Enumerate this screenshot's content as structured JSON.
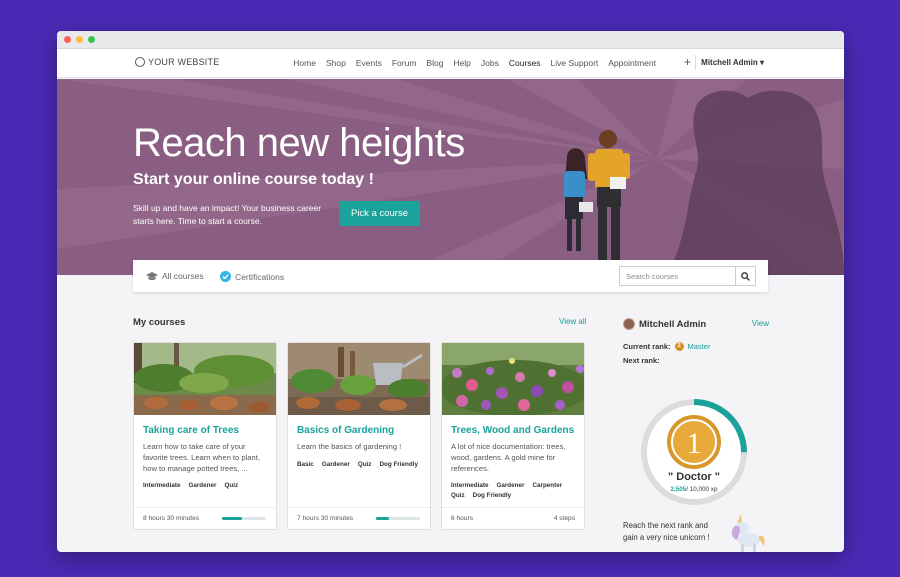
{
  "colors": {
    "accent": "#1aa29b",
    "hero_bg": "#8a5e82",
    "page_bg": "#4a2ab5",
    "rank_gold": "#d4912a"
  },
  "nav": {
    "brand": "YOUR WEBSITE",
    "items": [
      "Home",
      "Shop",
      "Events",
      "Forum",
      "Blog",
      "Help",
      "Jobs",
      "Courses",
      "Live Support",
      "Appointment"
    ],
    "active": "Courses",
    "user": "Mitchell Admin"
  },
  "hero": {
    "title": "Reach new heights",
    "subtitle": "Start your online course today !",
    "text": "Skill up and have an impact! Your business career starts here. Time to start a course.",
    "cta": "Pick a course"
  },
  "tabs": {
    "all_courses": "All courses",
    "certifications": "Certifications",
    "search_placeholder": "Search courses"
  },
  "my_courses": {
    "title": "My courses",
    "view_all": "View all",
    "cards": [
      {
        "title": "Taking care of Trees",
        "description": "Learn how to take care of your favorite trees. Learn when to plant, how to manage potted trees, ...",
        "tags": [
          "Intermediate",
          "Gardener",
          "Quiz"
        ],
        "duration": "8 hours 30 minutes",
        "progress": 0.45
      },
      {
        "title": "Basics of Gardening",
        "description": "Learn the basics of gardening !",
        "tags": [
          "Basic",
          "Gardener",
          "Quiz",
          "Dog Friendly"
        ],
        "duration": "7 hours 30 minutes",
        "progress": 0.3
      },
      {
        "title": "Trees, Wood and Gardens",
        "description": "A lot of nice documentation: trees, wood, gardens. A gold mine for references.",
        "tags": [
          "Intermediate",
          "Gardener",
          "Carpenter",
          "Quiz",
          "Dog Friendly"
        ],
        "duration": "6 hours",
        "steps": "4 steps"
      }
    ]
  },
  "profile": {
    "name": "Mitchell Admin",
    "view": "View",
    "current_rank_label": "Current rank:",
    "current_rank": "Master",
    "next_rank_label": "Next rank:",
    "rank_number": "1",
    "next_rank": "\" Doctor \"",
    "xp_current": "2,505",
    "xp_total": "/ 10,000 xp",
    "xp_progress": 0.2505,
    "next_message": "Reach the next rank and gain a very nice unicorn !"
  }
}
